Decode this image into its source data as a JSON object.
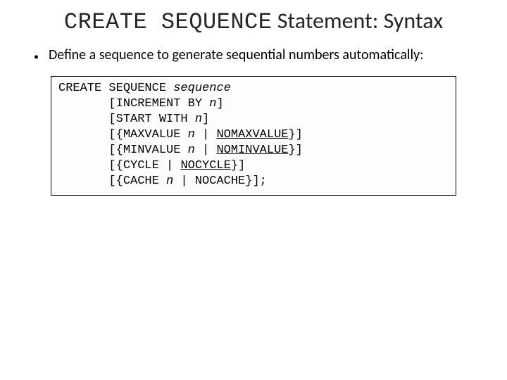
{
  "title_mono": "CREATE SEQUENCE",
  "title_rest": " Statement: Syntax",
  "bullet_text": "Define a sequence to generate sequential numbers automatically:",
  "code": {
    "l1a": "CREATE SEQUENCE ",
    "l1b": "sequence",
    "l2a": "       [INCREMENT BY ",
    "l2b": "n",
    "l2c": "]",
    "l3a": "       [START WITH ",
    "l3b": "n",
    "l3c": "]",
    "l4a": "       [{MAXVALUE ",
    "l4b": "n",
    "l4c": " | ",
    "l4d": "NOMAXVALUE",
    "l4e": "}]",
    "l5a": "       [{MINVALUE ",
    "l5b": "n",
    "l5c": " | ",
    "l5d": "NOMINVALUE",
    "l5e": "}]",
    "l6a": "       [{CYCLE | ",
    "l6b": "NOCYCLE",
    "l6c": "}]",
    "l7a": "       [{CACHE ",
    "l7b": "n",
    "l7c": " | NOCACHE}];"
  }
}
